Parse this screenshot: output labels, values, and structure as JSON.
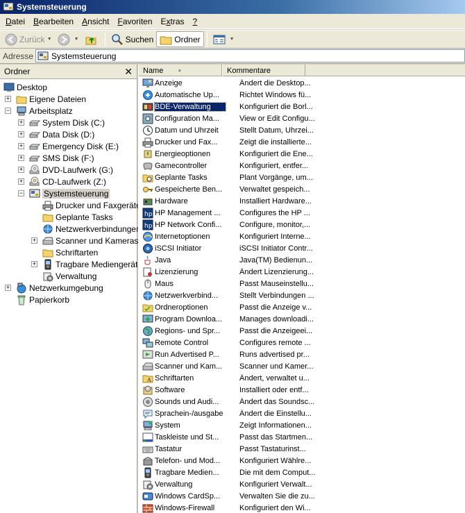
{
  "window": {
    "title": "Systemsteuerung"
  },
  "menu": [
    "Datei",
    "Bearbeiten",
    "Ansicht",
    "Favoriten",
    "Extras",
    "?"
  ],
  "menu_underline": [
    "D",
    "B",
    "A",
    "F",
    "x",
    "?"
  ],
  "toolbar": {
    "back": "Zurück",
    "search": "Suchen",
    "folders": "Ordner"
  },
  "address": {
    "label": "Adresse",
    "value": "Systemsteuerung"
  },
  "folder_pane": {
    "title": "Ordner",
    "tree": [
      {
        "label": "Desktop",
        "icon": "desktop-icon",
        "level": 0,
        "expander": ""
      },
      {
        "label": "Eigene Dateien",
        "icon": "folder-icon",
        "level": 1,
        "expander": "+"
      },
      {
        "label": "Arbeitsplatz",
        "icon": "computer-icon",
        "level": 1,
        "expander": "-"
      },
      {
        "label": "System Disk (C:)",
        "icon": "drive-icon",
        "level": 2,
        "expander": "+"
      },
      {
        "label": "Data Disk (D:)",
        "icon": "drive-icon",
        "level": 2,
        "expander": "+"
      },
      {
        "label": "Emergency Disk (E:)",
        "icon": "drive-icon",
        "level": 2,
        "expander": "+"
      },
      {
        "label": "SMS Disk (F:)",
        "icon": "drive-icon",
        "level": 2,
        "expander": "+"
      },
      {
        "label": "DVD-Laufwerk (G:)",
        "icon": "dvd-icon",
        "level": 2,
        "expander": "+"
      },
      {
        "label": "CD-Laufwerk (Z:)",
        "icon": "cd-icon",
        "level": 2,
        "expander": "+"
      },
      {
        "label": "Systemsteuerung",
        "icon": "control-panel-icon",
        "level": 2,
        "expander": "-",
        "selected": true
      },
      {
        "label": "Drucker und Faxgeräte",
        "icon": "printer-icon",
        "level": 3,
        "expander": ""
      },
      {
        "label": "Geplante Tasks",
        "icon": "folder-icon",
        "level": 3,
        "expander": ""
      },
      {
        "label": "Netzwerkverbindungen",
        "icon": "network-icon",
        "level": 3,
        "expander": ""
      },
      {
        "label": "Scanner und Kameras",
        "icon": "scanner-icon",
        "level": 3,
        "expander": "+"
      },
      {
        "label": "Schriftarten",
        "icon": "folder-icon",
        "level": 3,
        "expander": ""
      },
      {
        "label": "Tragbare Mediengeräte",
        "icon": "media-icon",
        "level": 3,
        "expander": "+"
      },
      {
        "label": "Verwaltung",
        "icon": "admin-icon",
        "level": 3,
        "expander": ""
      },
      {
        "label": "Netzwerkumgebung",
        "icon": "network-places-icon",
        "level": 1,
        "expander": "+"
      },
      {
        "label": "Papierkorb",
        "icon": "recycle-bin-icon",
        "level": 1,
        "expander": ""
      }
    ]
  },
  "list": {
    "columns": [
      "Name",
      "Kommentare"
    ],
    "rows": [
      {
        "name": "Anzeige",
        "comment": "Ändert die Desktop...",
        "icon": "display-icon"
      },
      {
        "name": "Automatische Up...",
        "comment": "Richtet Windows fü...",
        "icon": "update-icon"
      },
      {
        "name": "BDE-Verwaltung",
        "comment": "Konfiguriert die Borl...",
        "icon": "bde-icon",
        "selected": true
      },
      {
        "name": "Configuration Ma...",
        "comment": "View or Edit Configu...",
        "icon": "config-icon"
      },
      {
        "name": "Datum und Uhrzeit",
        "comment": "Stellt Datum, Uhrzei...",
        "icon": "clock-icon"
      },
      {
        "name": "Drucker und Fax...",
        "comment": "Zeigt die installierte...",
        "icon": "printer-icon"
      },
      {
        "name": "Energieoptionen",
        "comment": "Konfiguriert die Ene...",
        "icon": "power-icon"
      },
      {
        "name": "Gamecontroller",
        "comment": "Konfiguriert, entfer...",
        "icon": "gamepad-icon"
      },
      {
        "name": "Geplante Tasks",
        "comment": "Plant Vorgänge, um...",
        "icon": "tasks-icon"
      },
      {
        "name": "Gespeicherte Ben...",
        "comment": "Verwaltet gespeich...",
        "icon": "credentials-icon"
      },
      {
        "name": "Hardware",
        "comment": "Installiert Hardware...",
        "icon": "hardware-icon"
      },
      {
        "name": "HP Management ...",
        "comment": "Configures the HP ...",
        "icon": "hp-icon"
      },
      {
        "name": "HP Network Confi...",
        "comment": "Configure, monitor,...",
        "icon": "hp-icon"
      },
      {
        "name": "Internetoptionen",
        "comment": "Konfiguriert Interne...",
        "icon": "internet-icon"
      },
      {
        "name": "iSCSI Initiator",
        "comment": "iSCSI Initiator Contr...",
        "icon": "iscsi-icon"
      },
      {
        "name": "Java",
        "comment": "Java(TM) Bedienun...",
        "icon": "java-icon"
      },
      {
        "name": "Lizenzierung",
        "comment": "Ändert Lizenzierung...",
        "icon": "license-icon"
      },
      {
        "name": "Maus",
        "comment": "Passt Mauseinstellu...",
        "icon": "mouse-icon"
      },
      {
        "name": "Netzwerkverbind...",
        "comment": "Stellt Verbindungen ...",
        "icon": "network-icon"
      },
      {
        "name": "Ordneroptionen",
        "comment": "Passt die Anzeige v...",
        "icon": "folder-options-icon"
      },
      {
        "name": "Program Downloa...",
        "comment": "Manages downloadi...",
        "icon": "download-icon"
      },
      {
        "name": "Regions- und Spr...",
        "comment": "Passt die Anzeigeei...",
        "icon": "globe-icon"
      },
      {
        "name": "Remote Control",
        "comment": "Configures remote ...",
        "icon": "remote-icon"
      },
      {
        "name": "Run Advertised P...",
        "comment": "Runs advertised pr...",
        "icon": "run-icon"
      },
      {
        "name": "Scanner und Kam...",
        "comment": "Scanner und Kamer...",
        "icon": "scanner-icon"
      },
      {
        "name": "Schriftarten",
        "comment": "Ändert, verwaltet u...",
        "icon": "fonts-icon"
      },
      {
        "name": "Software",
        "comment": "Installiert oder entf...",
        "icon": "software-icon"
      },
      {
        "name": "Sounds und Audi...",
        "comment": "Ändert das Soundsc...",
        "icon": "sound-icon"
      },
      {
        "name": "Sprachein-/ausgabe",
        "comment": "Ändert die Einstellu...",
        "icon": "speech-icon"
      },
      {
        "name": "System",
        "comment": "Zeigt Informationen...",
        "icon": "system-icon"
      },
      {
        "name": "Taskleiste und St...",
        "comment": "Passt das Startmen...",
        "icon": "taskbar-icon"
      },
      {
        "name": "Tastatur",
        "comment": "Passt Tastaturinst...",
        "icon": "keyboard-icon"
      },
      {
        "name": "Telefon- und Mod...",
        "comment": "Konfiguriert Wählre...",
        "icon": "phone-icon"
      },
      {
        "name": "Tragbare Medien...",
        "comment": "Die mit dem Comput...",
        "icon": "media-icon"
      },
      {
        "name": "Verwaltung",
        "comment": "Konfiguriert Verwalt...",
        "icon": "admin-icon"
      },
      {
        "name": "Windows CardSp...",
        "comment": "Verwalten Sie die zu...",
        "icon": "cardspace-icon"
      },
      {
        "name": "Windows-Firewall",
        "comment": "Konfiguriert den Wi...",
        "icon": "firewall-icon"
      }
    ]
  },
  "colors": {
    "title_start": "#0a246a",
    "title_end": "#a6caf0",
    "selection": "#0a246a",
    "chrome": "#ece9d8"
  }
}
